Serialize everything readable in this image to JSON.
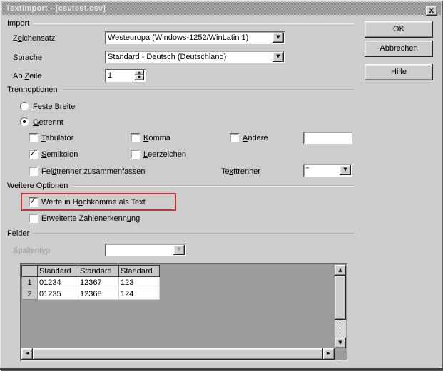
{
  "window": {
    "title": "Textimport - [csvtest.csv]"
  },
  "icons": {
    "close": "x",
    "dropdown_arrow": "▼",
    "spin_up": "▲",
    "spin_down": "▼",
    "scroll_up": "▲",
    "scroll_down": "▼",
    "scroll_left": "◄",
    "scroll_right": "►",
    "check": "✓"
  },
  "colors": {
    "annotation_red": "#c83232",
    "titlebar_gray": "#9c9c9c",
    "dialog_gray": "#cccccc"
  },
  "action_buttons": {
    "ok": "OK",
    "cancel": "Abbrechen",
    "help": {
      "pre": "",
      "u": "H",
      "post": "ilfe"
    }
  },
  "import": {
    "section_title": "Import",
    "charset_label": {
      "pre": "Z",
      "u": "e",
      "post": "ichensatz"
    },
    "charset_value": "Westeuropa (Windows-1252/WinLatin 1)",
    "language_label": {
      "pre": "Spra",
      "u": "c",
      "post": "he"
    },
    "language_value": "Standard - Deutsch (Deutschland)",
    "from_row_label": {
      "pre": "Ab ",
      "u": "Z",
      "post": "eile"
    },
    "from_row_value": "1"
  },
  "trennoptionen": {
    "section_title": "Trennoptionen",
    "fixed_width_label": {
      "pre": "",
      "u": "F",
      "post": "este Breite"
    },
    "fixed_width_selected": false,
    "separated_label": {
      "pre": "",
      "u": "G",
      "post": "etrennt"
    },
    "separated_selected": true,
    "tab_label": {
      "pre": "",
      "u": "T",
      "post": "abulator"
    },
    "tab_checked": false,
    "comma_label": {
      "pre": "",
      "u": "K",
      "post": "omma"
    },
    "comma_checked": false,
    "other_label": {
      "pre": "",
      "u": "A",
      "post": "ndere"
    },
    "other_checked": false,
    "other_value": "",
    "semicolon_label": {
      "pre": "",
      "u": "S",
      "post": "emikolon"
    },
    "semicolon_checked": true,
    "space_label": {
      "pre": "",
      "u": "L",
      "post": "eerzeichen"
    },
    "space_checked": false,
    "merge_label": {
      "pre": "Fel",
      "u": "d",
      "post": "trenner zusammenfassen"
    },
    "merge_checked": false,
    "text_delimiter_label": {
      "pre": "Te",
      "u": "x",
      "post": "ttrenner"
    },
    "text_delimiter_value": "\""
  },
  "weitere_optionen": {
    "section_title": "Weitere Optionen",
    "quoted_as_text_label": {
      "pre": "Werte in H",
      "u": "o",
      "post": "chkomma als Text"
    },
    "quoted_as_text_checked": true,
    "number_detect_label": {
      "pre": "Erweiterte Zahlenerkenn",
      "u": "u",
      "post": "ng"
    },
    "number_detect_checked": false
  },
  "felder": {
    "section_title": "Felder",
    "column_type_label": {
      "pre": "Spaltent",
      "u": "y",
      "post": "p"
    },
    "column_type_value": "",
    "table": {
      "headers": [
        "Standard",
        "Standard",
        "Standard"
      ],
      "rows": [
        {
          "num": "1",
          "cells": [
            "01234",
            "12367",
            "123"
          ]
        },
        {
          "num": "2",
          "cells": [
            "01235",
            "12368",
            "124"
          ]
        }
      ]
    }
  }
}
